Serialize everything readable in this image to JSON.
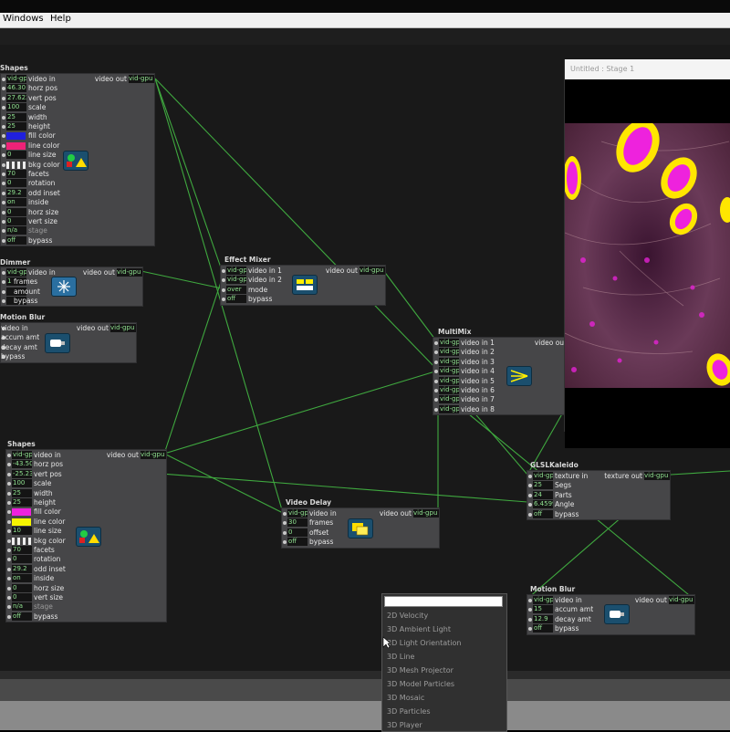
{
  "menubar": {
    "items": [
      "Windows",
      "Help"
    ]
  },
  "stage": {
    "title": "Untitled : Stage 1"
  },
  "actors": {
    "shapes_top": {
      "title": "Shapes",
      "output": {
        "label": "video out",
        "value": "vid-gpu"
      },
      "inputs": [
        {
          "value": "vid-gpu",
          "name": "video in"
        },
        {
          "value": "46.30",
          "name": "horz pos"
        },
        {
          "value": "27.622",
          "name": "vert pos"
        },
        {
          "value": "100",
          "name": "scale"
        },
        {
          "value": "25",
          "name": "width"
        },
        {
          "value": "25",
          "name": "height"
        },
        {
          "value": "",
          "name": "fill color"
        },
        {
          "value": "",
          "name": "line color"
        },
        {
          "value": "0",
          "name": "line size"
        },
        {
          "value": "",
          "name": "bkg color"
        },
        {
          "value": "70",
          "name": "facets"
        },
        {
          "value": "0",
          "name": "rotation"
        },
        {
          "value": "29.2",
          "name": "odd inset"
        },
        {
          "value": "on",
          "name": "inside"
        },
        {
          "value": "0",
          "name": "horz size"
        },
        {
          "value": "0",
          "name": "vert size"
        },
        {
          "value": "n/a",
          "name": "stage"
        },
        {
          "value": "off",
          "name": "bypass"
        }
      ]
    },
    "dimmer": {
      "title": "Dimmer",
      "output": {
        "label": "video out",
        "value": "vid-gpu"
      },
      "inputs": [
        {
          "value": "vid-gpu",
          "name": "video in"
        },
        {
          "value": "1",
          "name": "frames"
        },
        {
          "value": "",
          "name": "amount"
        },
        {
          "value": "",
          "name": "bypass"
        }
      ]
    },
    "motion_blur_left": {
      "title": "Motion Blur",
      "output": {
        "label": "video out",
        "value": "vid-gpu"
      },
      "inputs": [
        {
          "value": "",
          "name": "video in"
        },
        {
          "value": "",
          "name": "accum amt"
        },
        {
          "value": "",
          "name": "decay amt"
        },
        {
          "value": "",
          "name": "bypass"
        }
      ]
    },
    "effect_mixer": {
      "title": "Effect Mixer",
      "output": {
        "label": "video out",
        "value": "vid-gpu"
      },
      "inputs": [
        {
          "value": "vid-gpu",
          "name": "video in 1"
        },
        {
          "value": "vid-gpu",
          "name": "video in 2"
        },
        {
          "value": "over",
          "name": "mode"
        },
        {
          "value": "off",
          "name": "bypass"
        }
      ]
    },
    "multimix": {
      "title": "MultiMix",
      "output": {
        "label": "video out",
        "value": ""
      },
      "inputs": [
        {
          "value": "vid-gpu",
          "name": "video in 1"
        },
        {
          "value": "vid-gpu",
          "name": "video in 2"
        },
        {
          "value": "vid-gpu",
          "name": "video in 3"
        },
        {
          "value": "vid-gpu",
          "name": "video in 4"
        },
        {
          "value": "vid-gpu",
          "name": "video in 5"
        },
        {
          "value": "vid-gpu",
          "name": "video in 6"
        },
        {
          "value": "vid-gpu",
          "name": "video in 7"
        },
        {
          "value": "vid-gpu",
          "name": "video in 8"
        }
      ]
    },
    "shapes_bottom": {
      "title": "Shapes",
      "output": {
        "label": "video out",
        "value": "vid-gpu"
      },
      "inputs": [
        {
          "value": "vid-gpu",
          "name": "video in"
        },
        {
          "value": "-43.50",
          "name": "horz pos"
        },
        {
          "value": "-25.236",
          "name": "vert pos"
        },
        {
          "value": "100",
          "name": "scale"
        },
        {
          "value": "25",
          "name": "width"
        },
        {
          "value": "25",
          "name": "height"
        },
        {
          "value": "",
          "name": "fill color"
        },
        {
          "value": "",
          "name": "line color"
        },
        {
          "value": "10",
          "name": "line size"
        },
        {
          "value": "",
          "name": "bkg color"
        },
        {
          "value": "70",
          "name": "facets"
        },
        {
          "value": "0",
          "name": "rotation"
        },
        {
          "value": "29.2",
          "name": "odd inset"
        },
        {
          "value": "on",
          "name": "inside"
        },
        {
          "value": "0",
          "name": "horz size"
        },
        {
          "value": "0",
          "name": "vert size"
        },
        {
          "value": "n/a",
          "name": "stage"
        },
        {
          "value": "off",
          "name": "bypass"
        }
      ]
    },
    "video_delay": {
      "title": "Video Delay",
      "output": {
        "label": "video out",
        "value": "vid-gpu"
      },
      "inputs": [
        {
          "value": "vid-gpu",
          "name": "video in"
        },
        {
          "value": "30",
          "name": "frames"
        },
        {
          "value": "0",
          "name": "offset"
        },
        {
          "value": "off",
          "name": "bypass"
        }
      ]
    },
    "kaleido": {
      "title": "GLSLKaleido",
      "output": {
        "label": "texture out",
        "value": "vid-gpu"
      },
      "inputs": [
        {
          "value": "vid-gpu",
          "name": "texture in"
        },
        {
          "value": "25",
          "name": "Segs"
        },
        {
          "value": "24",
          "name": "Parts"
        },
        {
          "value": "6.4599",
          "name": "Angle"
        },
        {
          "value": "off",
          "name": "bypass"
        }
      ]
    },
    "motion_blur_right": {
      "title": "Motion Blur",
      "output": {
        "label": "video out",
        "value": "vid-gpu"
      },
      "inputs": [
        {
          "value": "vid-gpu",
          "name": "video in"
        },
        {
          "value": "15",
          "name": "accum amt"
        },
        {
          "value": "12.9",
          "name": "decay amt"
        },
        {
          "value": "off",
          "name": "bypass"
        }
      ]
    }
  },
  "popup": {
    "items": [
      "2D Velocity",
      "3D Ambient Light",
      "3D Light Orientation",
      "3D Line",
      "3D Mesh Projector",
      "3D Model Particles",
      "3D Mosaic",
      "3D Particles",
      "3D Player"
    ]
  },
  "colors": {
    "fill_top": "#2020dd",
    "line_top": "#ee2277",
    "fill_bottom": "#ee22dd",
    "line_bottom": "#f5f500",
    "wire": "#3fa83f"
  }
}
